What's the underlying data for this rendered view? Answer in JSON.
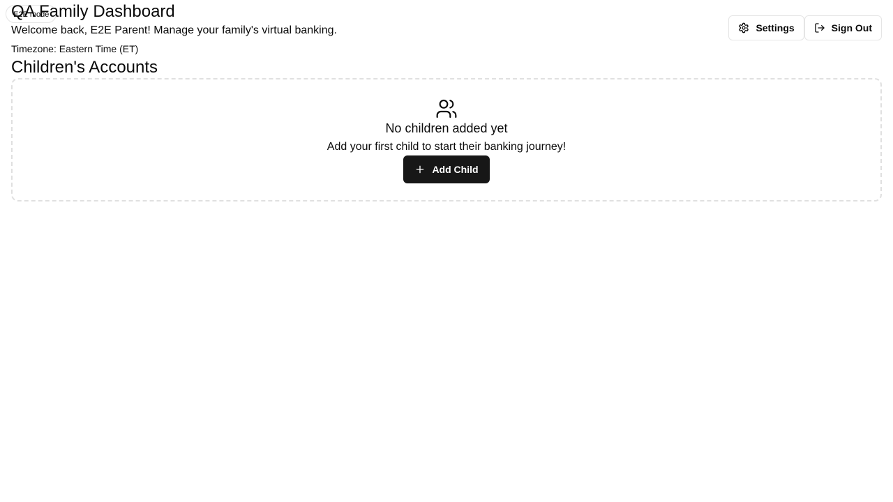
{
  "badge": {
    "label": "E2E mode"
  },
  "header": {
    "title": "QA Family Dashboard",
    "welcome": "Welcome back, E2E Parent! Manage your family's virtual banking.",
    "timezone": "Timezone: Eastern Time (ET)"
  },
  "actions": {
    "settings_label": "Settings",
    "settings_icon": "gear-icon",
    "signout_label": "Sign Out",
    "signout_icon": "log-out-icon"
  },
  "children_section": {
    "title": "Children's Accounts",
    "empty_icon": "users-icon",
    "empty_title": "No children added yet",
    "empty_subtitle": "Add your first child to start their banking journey!",
    "add_label": "Add Child",
    "add_icon": "plus-icon"
  },
  "colors": {
    "primary_button": "#171717",
    "border": "#e5e5e5",
    "text": "#0a0a0a"
  }
}
